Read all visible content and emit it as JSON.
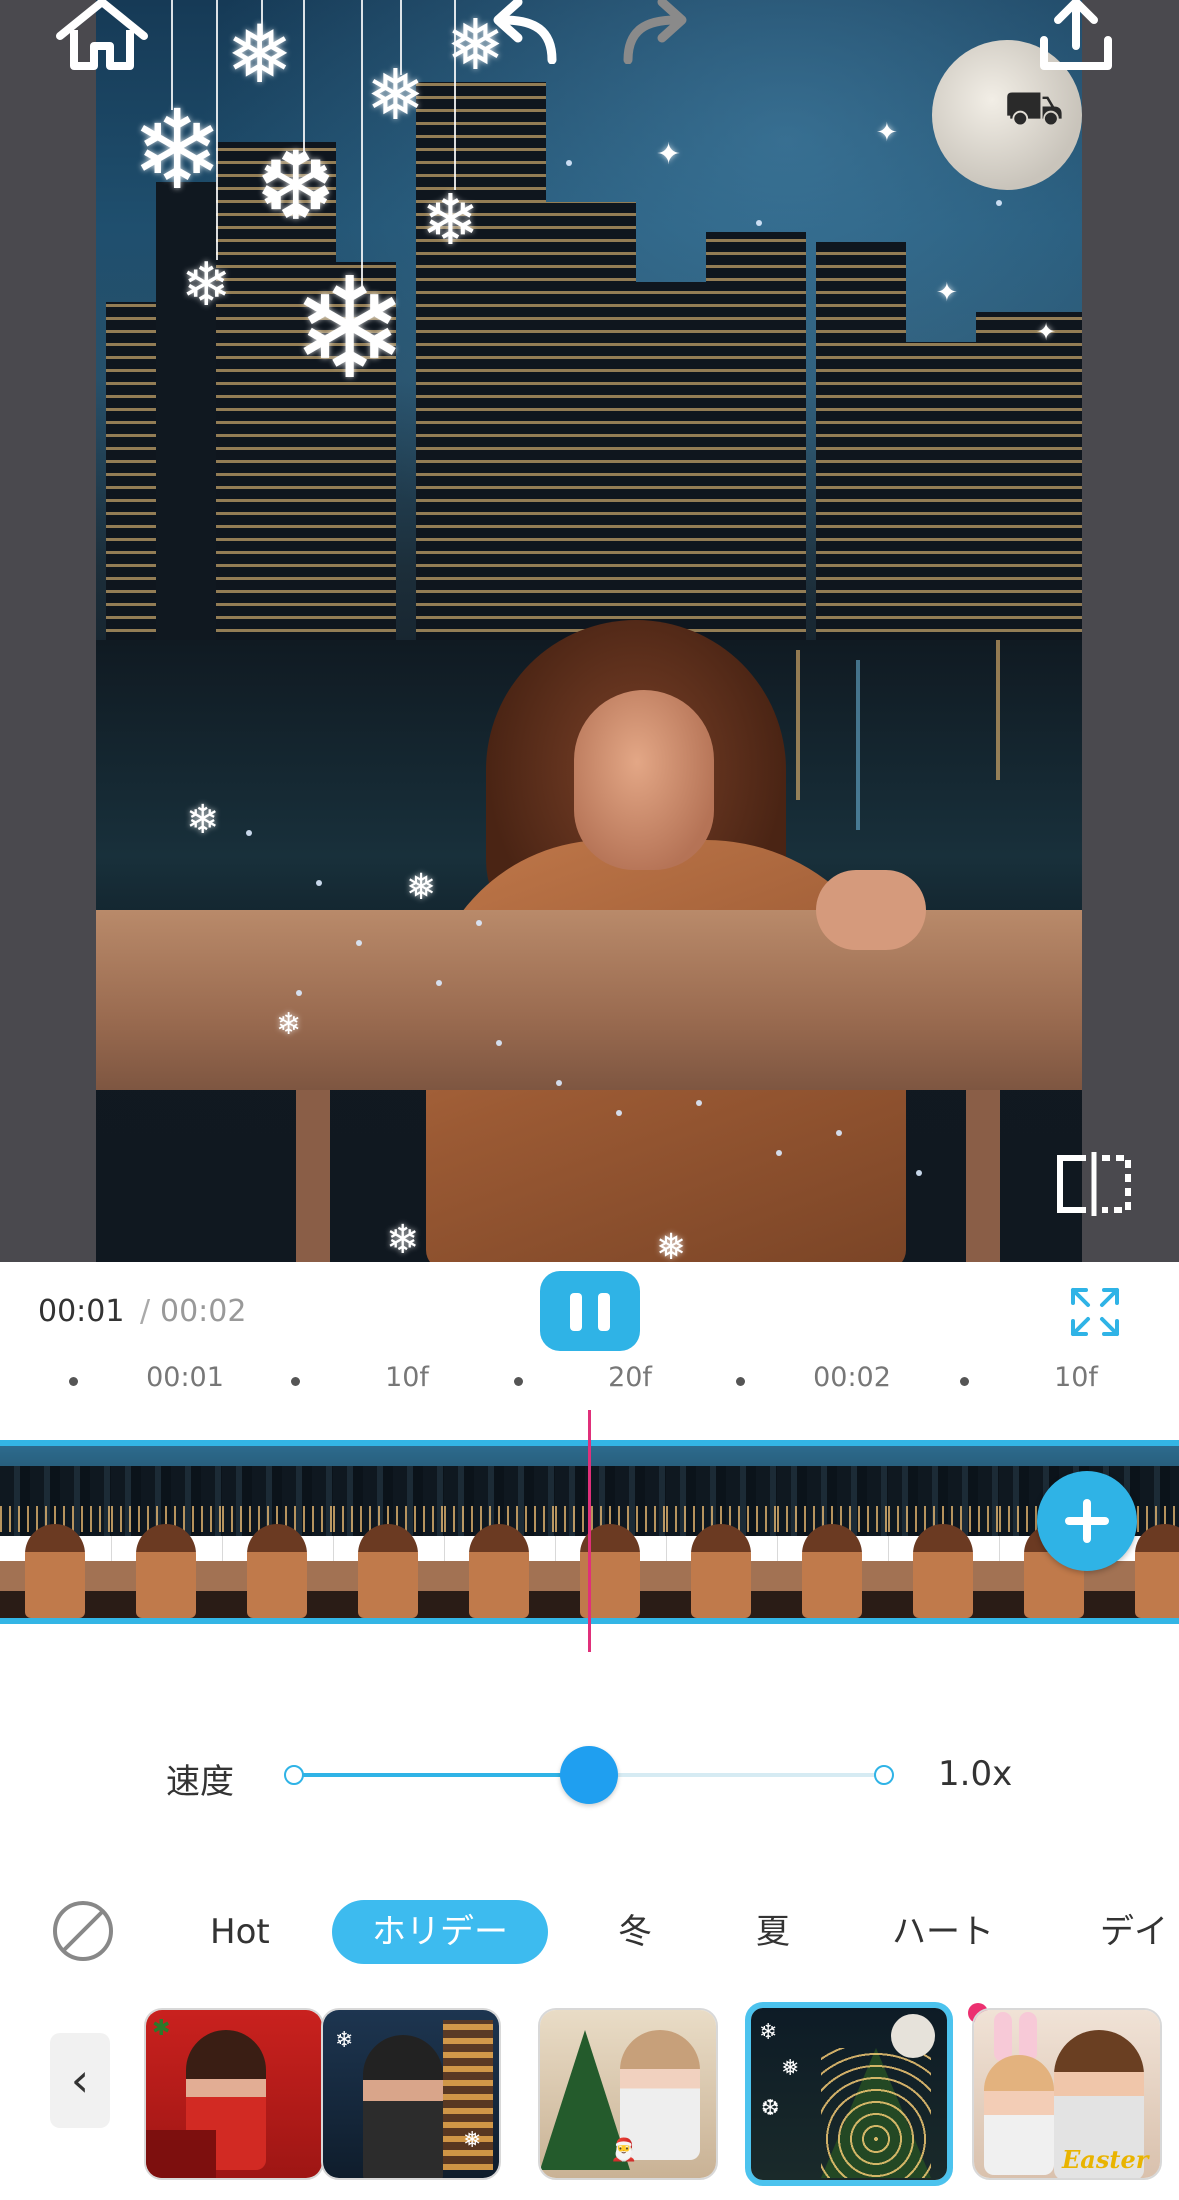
{
  "player": {
    "current_time": "00:01",
    "separator": "/",
    "total_time": "00:02"
  },
  "timeline_ruler": [
    "00:01",
    "10f",
    "20f",
    "00:02",
    "10f"
  ],
  "speed": {
    "label": "速度",
    "value_text": "1.0x",
    "slider_fraction": 0.5
  },
  "categories": [
    {
      "label": "Hot",
      "active": false
    },
    {
      "label": "ホリデー",
      "active": true
    },
    {
      "label": "冬",
      "active": false
    },
    {
      "label": "夏",
      "active": false
    },
    {
      "label": "ハート",
      "active": false
    },
    {
      "label": "デイ",
      "active": false
    }
  ],
  "effect_thumbnails": [
    {
      "name": "red-holiday",
      "selected": false
    },
    {
      "name": "snowy-night",
      "selected": false
    },
    {
      "name": "christmas-tree-family",
      "selected": false
    },
    {
      "name": "moon-tree-snowflakes",
      "selected": true
    },
    {
      "name": "easter-bunny",
      "selected": false,
      "new": true,
      "text": "Easter"
    }
  ],
  "icons": {
    "home": "home-icon",
    "undo": "undo-icon",
    "redo": "redo-icon",
    "export": "share-icon",
    "compare": "compare-icon",
    "pause": "pause-icon",
    "fullscreen": "fullscreen-icon",
    "add_clip": "plus-icon",
    "none_effect": "no-effect-icon",
    "back": "chevron-left-icon"
  },
  "colors": {
    "accent": "#2fb3e6",
    "playhead": "#e0307a",
    "new_badge": "#ec3070"
  }
}
